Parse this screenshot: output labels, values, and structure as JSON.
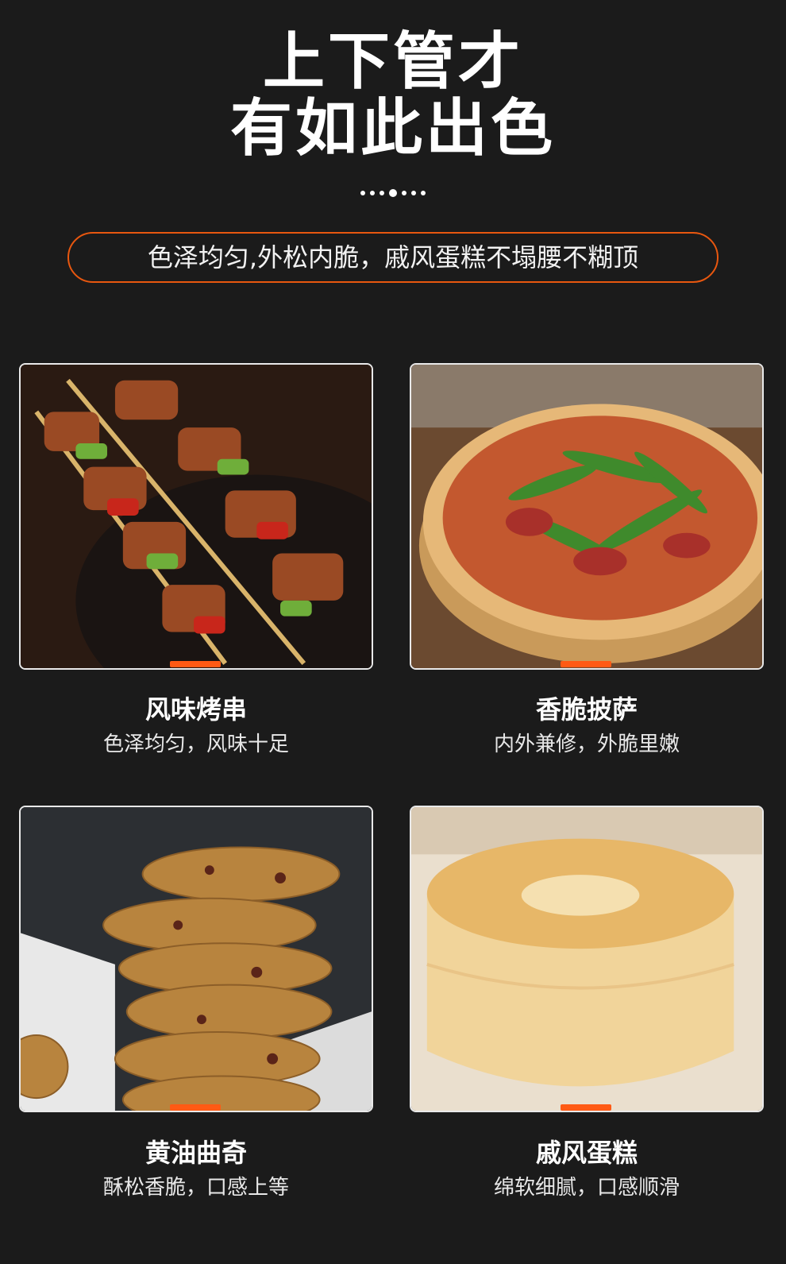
{
  "header": {
    "title_line1": "上下管才",
    "title_line2": "有如此出色",
    "tagline": "色泽均匀,外松内脆，戚风蛋糕不塌腰不糊顶"
  },
  "items": [
    {
      "name": "风味烤串",
      "desc": "色泽均匀，风味十足"
    },
    {
      "name": "香脆披萨",
      "desc": "内外兼修，外脆里嫩"
    },
    {
      "name": "黄油曲奇",
      "desc": "酥松香脆，口感上等"
    },
    {
      "name": "戚风蛋糕",
      "desc": "绵软细腻，口感顺滑"
    }
  ],
  "colors": {
    "background": "#1b1b1b",
    "accent": "#ff5a14",
    "border": "#e8570f"
  }
}
